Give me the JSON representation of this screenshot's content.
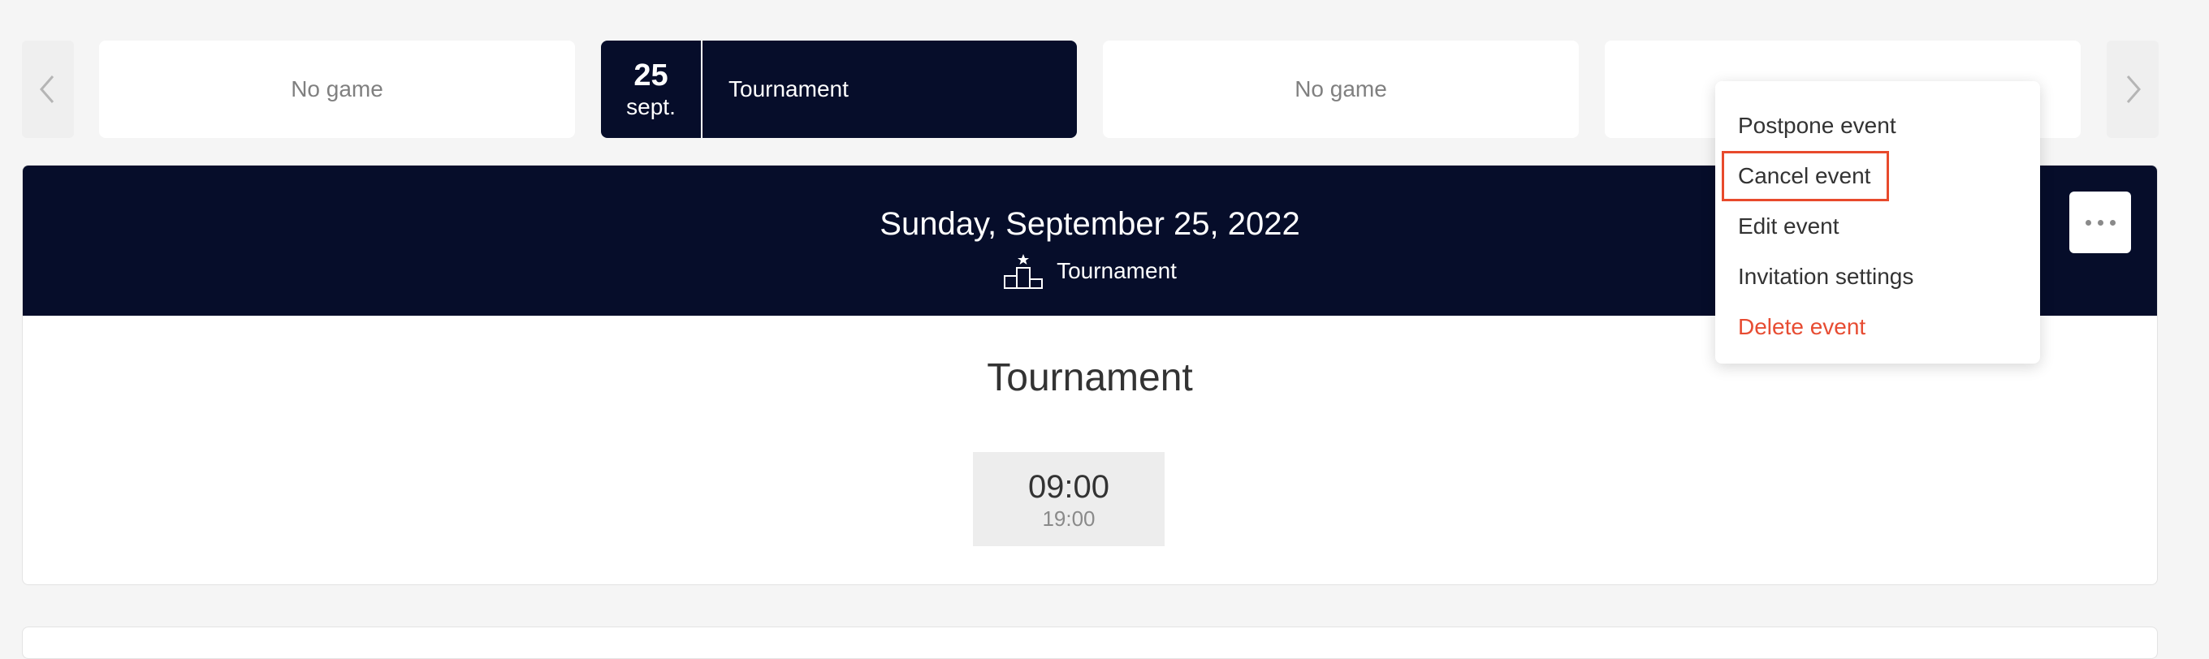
{
  "nav": {
    "prev_icon": "chevron-left-icon",
    "next_icon": "chevron-right-icon"
  },
  "days": [
    {
      "label": "No game"
    },
    {
      "day": "25",
      "month": "sept.",
      "label": "Tournament"
    },
    {
      "label": "No game"
    },
    {
      "label": ""
    }
  ],
  "event": {
    "date": "Sunday, September 25, 2022",
    "type_label": "Tournament",
    "type_icon": "podium-icon",
    "title": "Tournament",
    "start_time": "09:00",
    "end_time": "19:00"
  },
  "menu": {
    "items": [
      {
        "label": "Postpone event"
      },
      {
        "label": "Cancel event"
      },
      {
        "label": "Edit event"
      },
      {
        "label": "Invitation settings"
      },
      {
        "label": "Delete event"
      }
    ]
  },
  "colors": {
    "header_bg": "#060d2a",
    "danger": "#e74c32",
    "highlight": "#e84a2c"
  }
}
